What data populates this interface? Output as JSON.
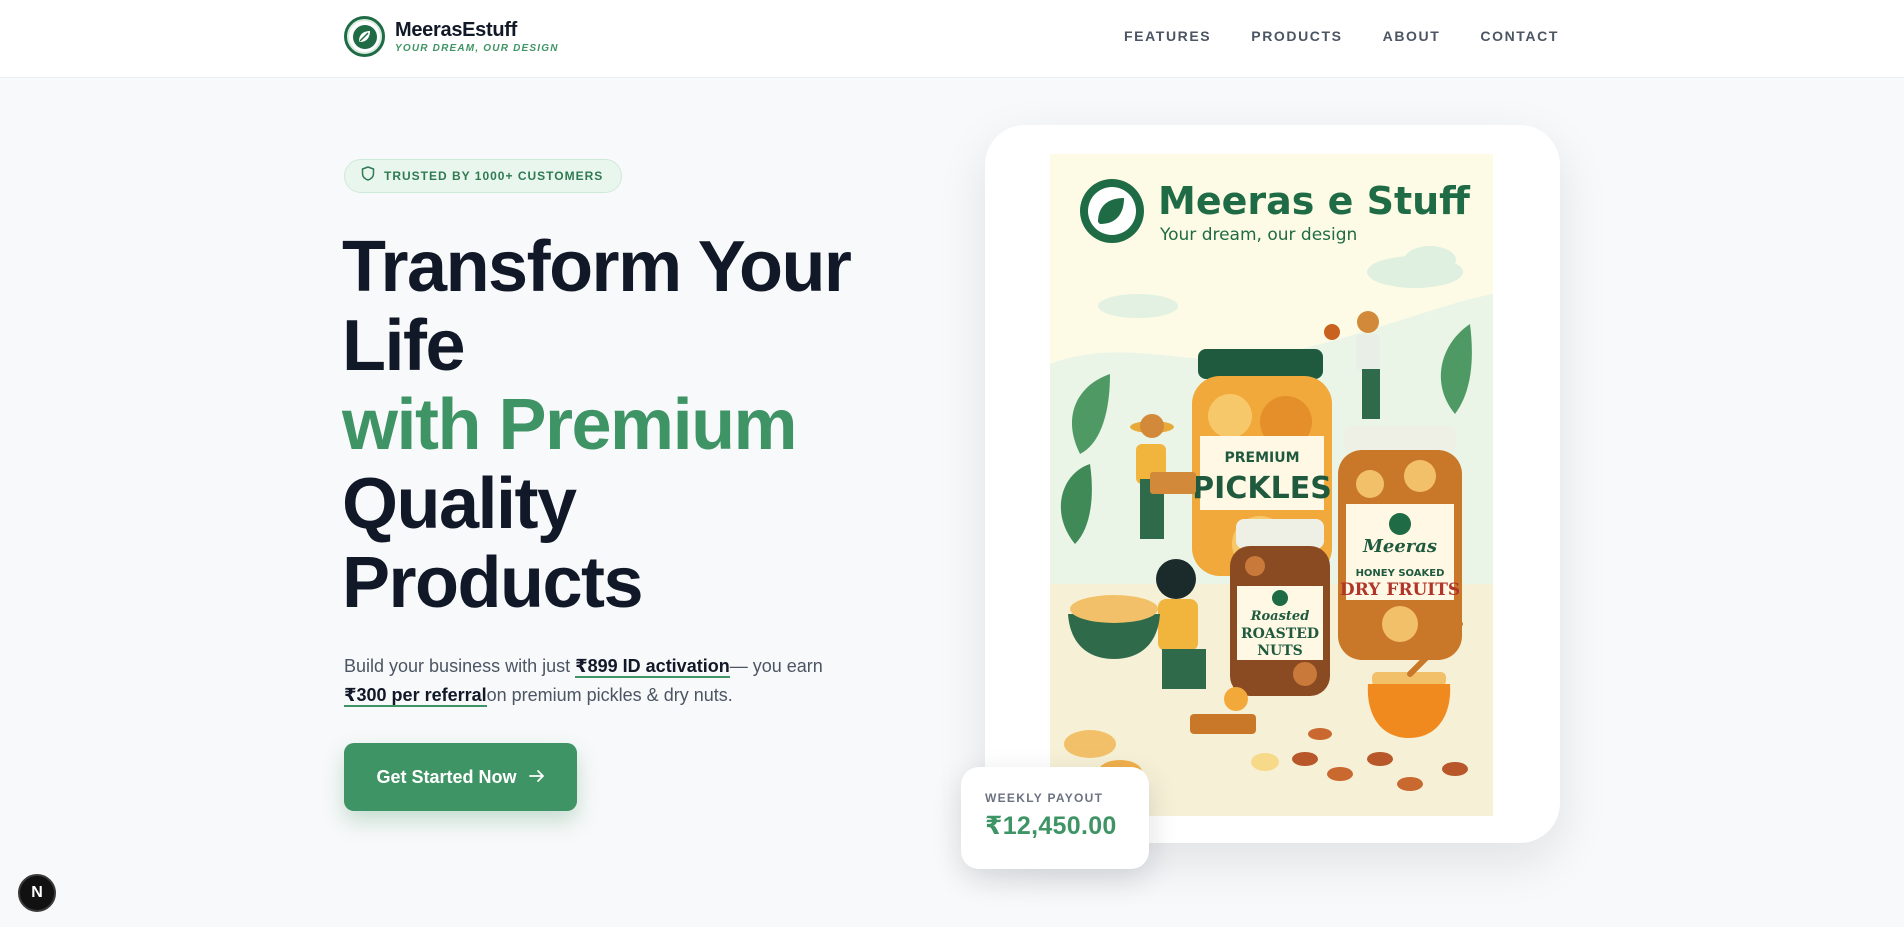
{
  "brand": {
    "name": "MeerasEstuff",
    "tagline": "YOUR DREAM, OUR DESIGN"
  },
  "nav": {
    "features": "FEATURES",
    "products": "PRODUCTS",
    "about": "ABOUT",
    "contact": "CONTACT"
  },
  "hero": {
    "badge": "TRUSTED BY 1000+ CUSTOMERS",
    "headline_line1": "Transform Your",
    "headline_line2": "Life",
    "headline_highlight": "with Premium",
    "headline_line3": "Quality",
    "headline_line4": "Products",
    "sub_prefix": "Build your business with just ",
    "sub_activation": "₹899 ID activation",
    "sub_middle": "— you earn",
    "sub_referral": "₹300 per referral",
    "sub_suffix": "on premium pickles & dry nuts.",
    "cta": "Get Started Now"
  },
  "poster": {
    "brand": "Meeras e Stuff",
    "tagline": "Your dream, our design",
    "jar_pickles_top": "PREMIUM",
    "jar_pickles_main": "PICKLES",
    "jar_dryfruits_brand": "Meeras",
    "jar_dryfruits_top": "HONEY SOAKED",
    "jar_dryfruits_main": "DRY FRUITS",
    "jar_nuts_script": "Roasted",
    "jar_nuts_main1": "ROASTED",
    "jar_nuts_main2": "NUTS"
  },
  "payout": {
    "label": "WEEKLY PAYOUT",
    "amount": "₹12,450.00"
  },
  "dev_badge": "N",
  "colors": {
    "brand_green": "#3f9465",
    "dark_green": "#1f6b45",
    "heading": "#111827",
    "badge_bg": "#e9f6ee"
  }
}
